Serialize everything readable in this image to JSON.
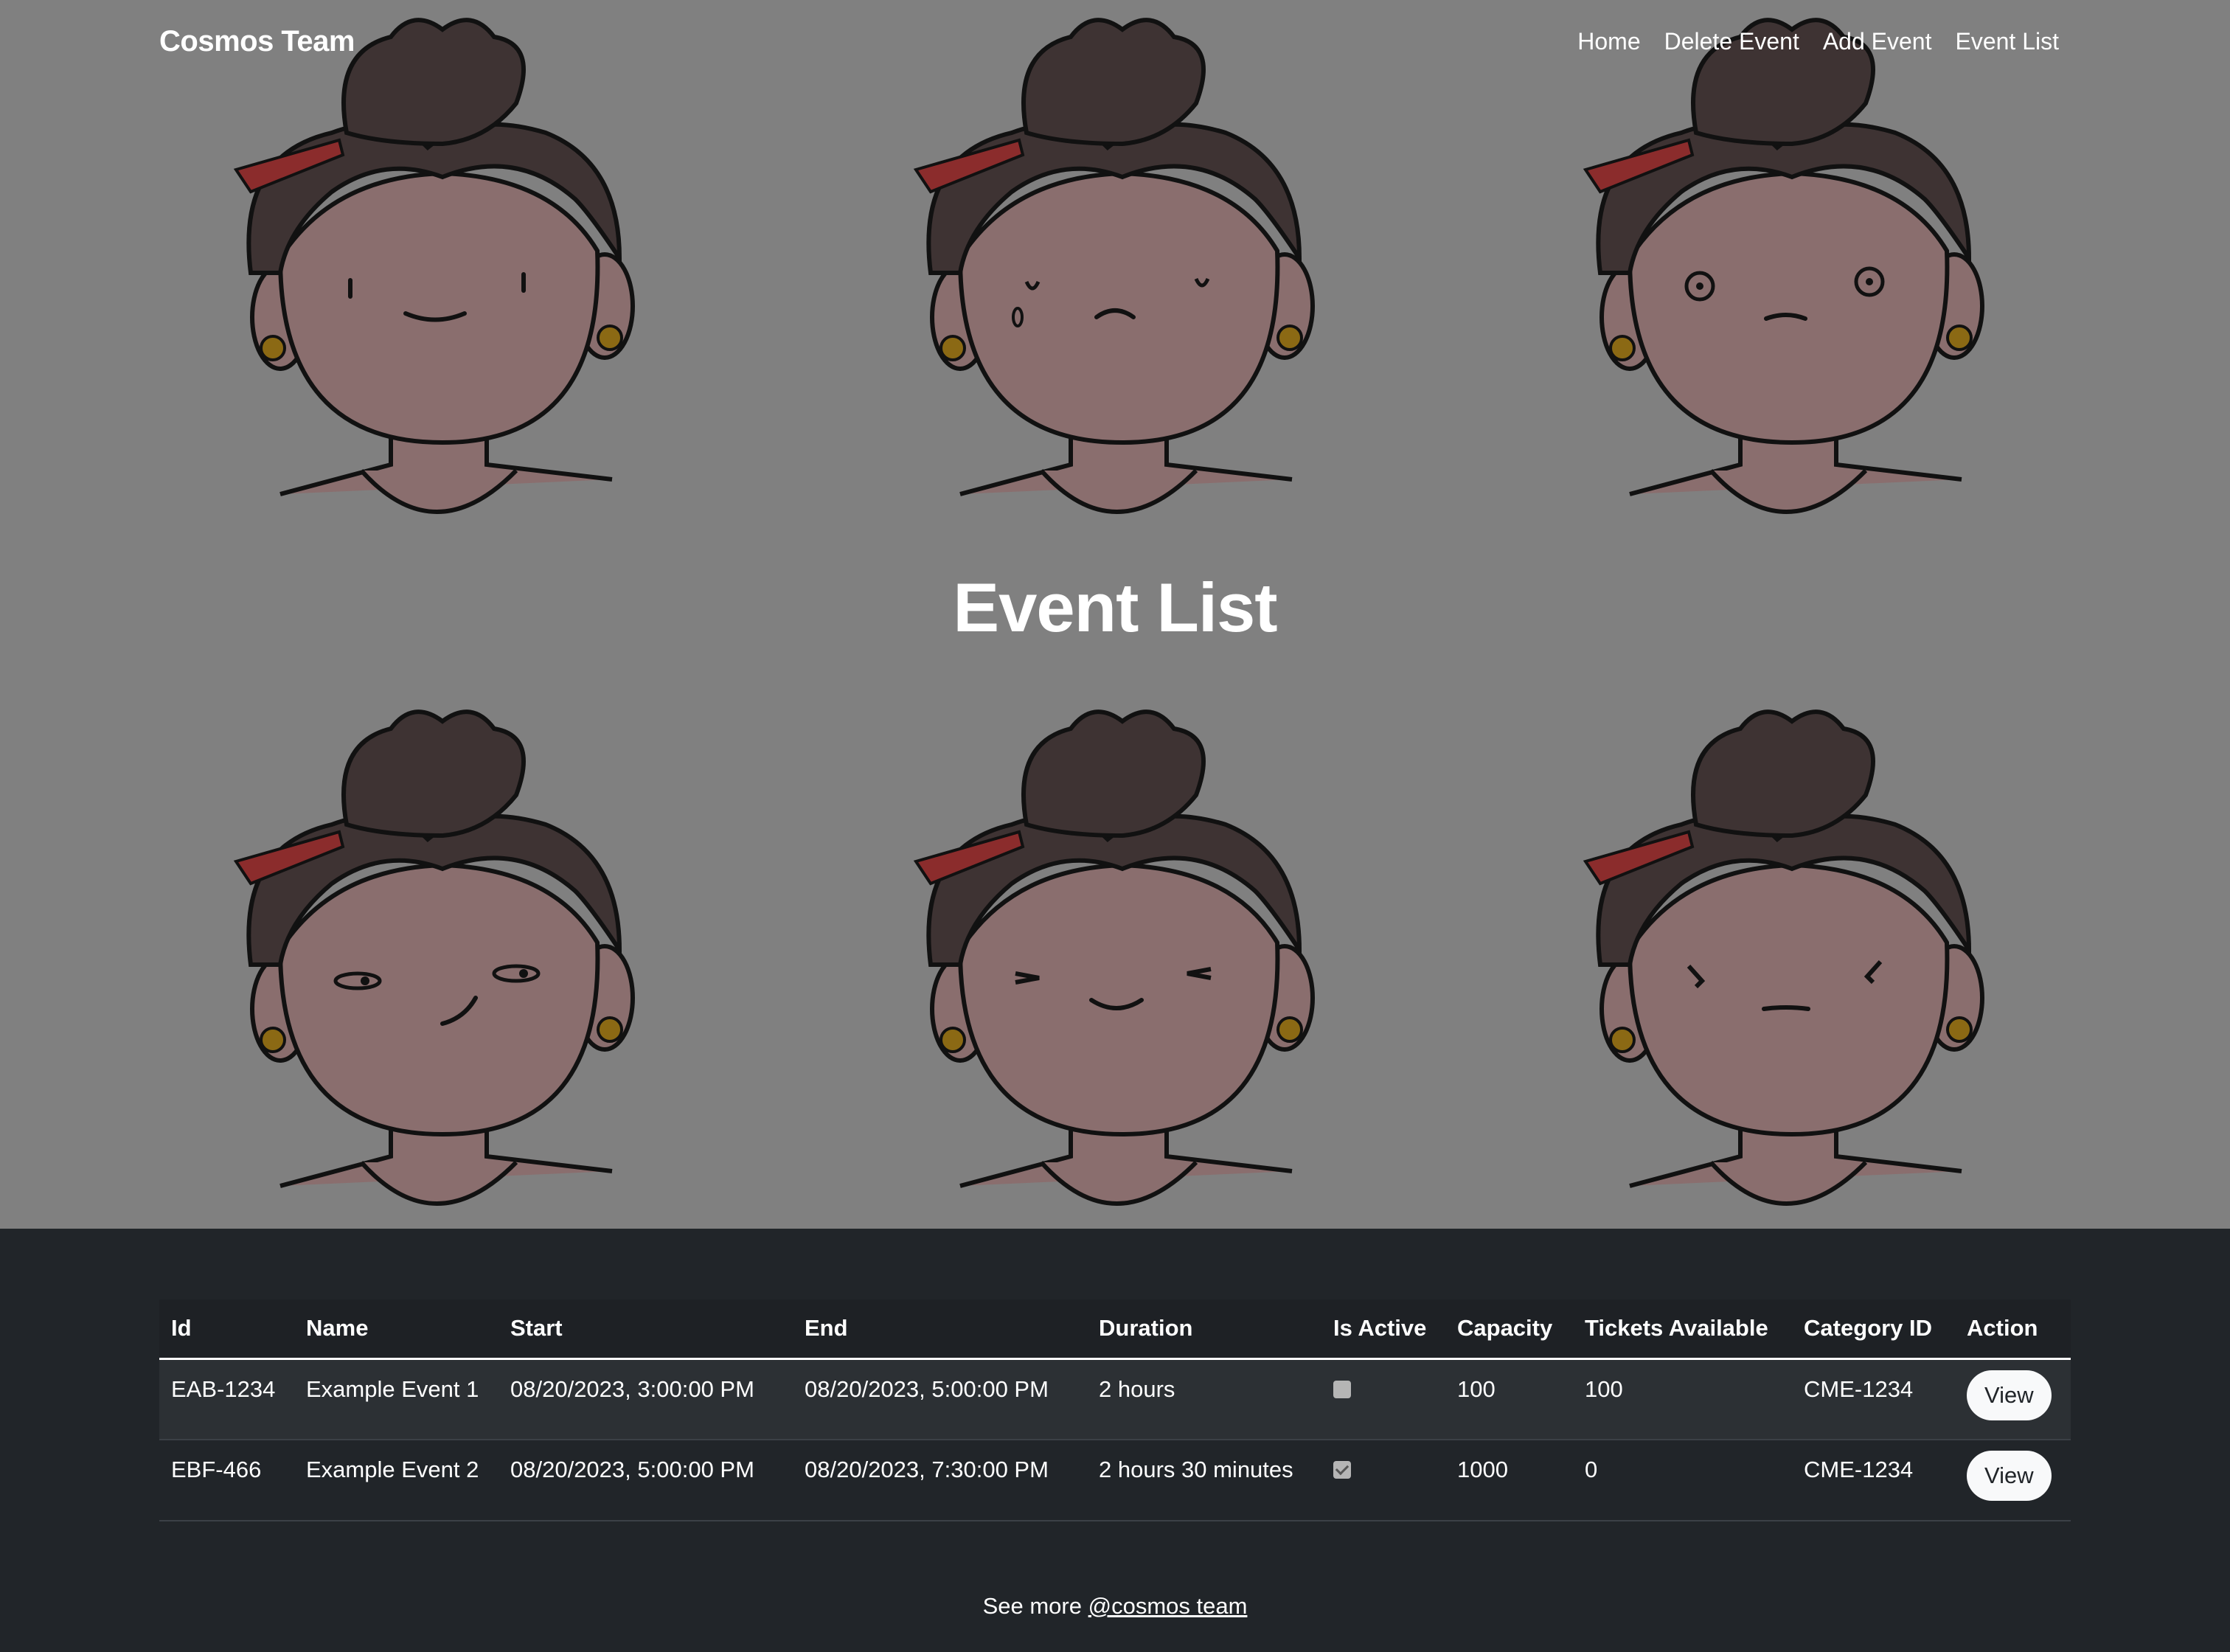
{
  "navbar": {
    "brand": "Cosmos Team",
    "links": [
      {
        "label": "Home"
      },
      {
        "label": "Delete Event"
      },
      {
        "label": "Add Event"
      },
      {
        "label": "Event List"
      }
    ]
  },
  "hero": {
    "title": "Event List"
  },
  "table": {
    "headers": [
      "Id",
      "Name",
      "Start",
      "End",
      "Duration",
      "Is Active",
      "Capacity",
      "Tickets Available",
      "Category ID",
      "Action"
    ],
    "rows": [
      {
        "id": "EAB-1234",
        "name": "Example Event 1",
        "start": "08/20/2023, 3:00:00 PM",
        "end": "08/20/2023, 5:00:00 PM",
        "duration": "2 hours",
        "is_active": false,
        "capacity": "100",
        "tickets_available": "100",
        "category_id": "CME-1234",
        "action": "View"
      },
      {
        "id": "EBF-466",
        "name": "Example Event 2",
        "start": "08/20/2023, 5:00:00 PM",
        "end": "08/20/2023, 7:30:00 PM",
        "duration": "2 hours 30 minutes",
        "is_active": true,
        "capacity": "1000",
        "tickets_available": "0",
        "category_id": "CME-1234",
        "action": "View"
      }
    ]
  },
  "footer": {
    "prefix": "See more",
    "link_label": "@cosmos team"
  },
  "colors": {
    "hero_bg": "#808080",
    "page_bg": "#212529",
    "button_bg": "#f8f9fa"
  }
}
